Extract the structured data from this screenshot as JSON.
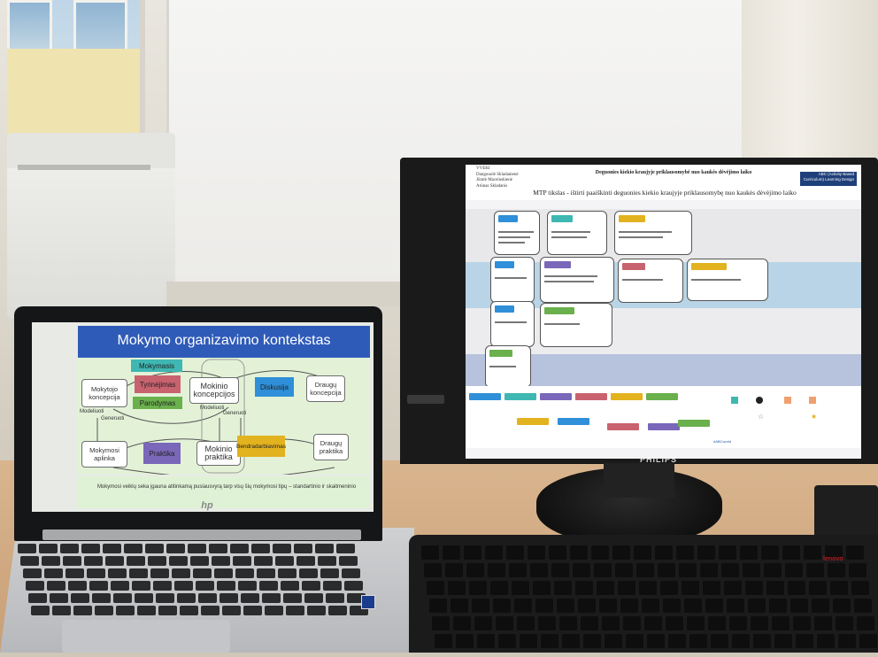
{
  "monitor": {
    "brand": "PHILIPS",
    "screen": {
      "authors": [
        "VVEKI",
        "Dangouolė Skladanienė",
        "Jūratė Maceinskienė",
        "Arūnas Skladanis"
      ],
      "title": "Deguonies kiekio kraujyje priklausomybė nuo kaukės dėvėjimo laiko",
      "brand_line1": "ABC (Activity Based",
      "brand_line2": "Curriculum) Learning Design",
      "subtitle": "MTP tikslas - ištirti paaiškinti deguonies kiekio kraujyje priklausomybę nuo kaukės dėvėjimo laiko",
      "footer_logo": "#ABCworld"
    }
  },
  "laptop": {
    "slide": {
      "title": "Mokymo organizavimo kontekstas",
      "boxes": {
        "mokytojo": "Mokytojo koncepcija",
        "mokymasis": "Mokymasis",
        "tyrinejimas": "Tyrinėjimas",
        "parodymas": "Parodymas",
        "mokinio_konc": "Mokinio koncepcijos",
        "diskusija": "Diskusija",
        "draugu_konc": "Draugų koncepcija",
        "modeliuoti_1": "Modeliuoti",
        "generuoti_1": "Generuoti",
        "modeliuoti_2": "Modeliuoti",
        "generuoti_2": "Generuoti",
        "aplinka": "Mokymosi aplinka",
        "praktika": "Praktika",
        "mokinio_prakt": "Mokinio praktika",
        "bendradarbiavimas": "Bendradarbiavimas",
        "draugu_prakt": "Draugų praktika"
      },
      "caption": "Mokymosi veiklų seka įgauna atitinkamą pusiausvyrą tarp visų šių mokymosi tipų – standartinio ir skaitmeninio"
    },
    "brand_logo": "hp"
  },
  "keyboard": {
    "brand": "lenovo"
  },
  "colors": {
    "slide_title_bg": "#2f5bb8",
    "teal": "#3fb7b2",
    "pink": "#c9626f",
    "green": "#6ab04c",
    "blue": "#2f8fd8",
    "purple": "#7a67b9",
    "gold": "#e3b21f",
    "desk": "#d1aa80"
  }
}
